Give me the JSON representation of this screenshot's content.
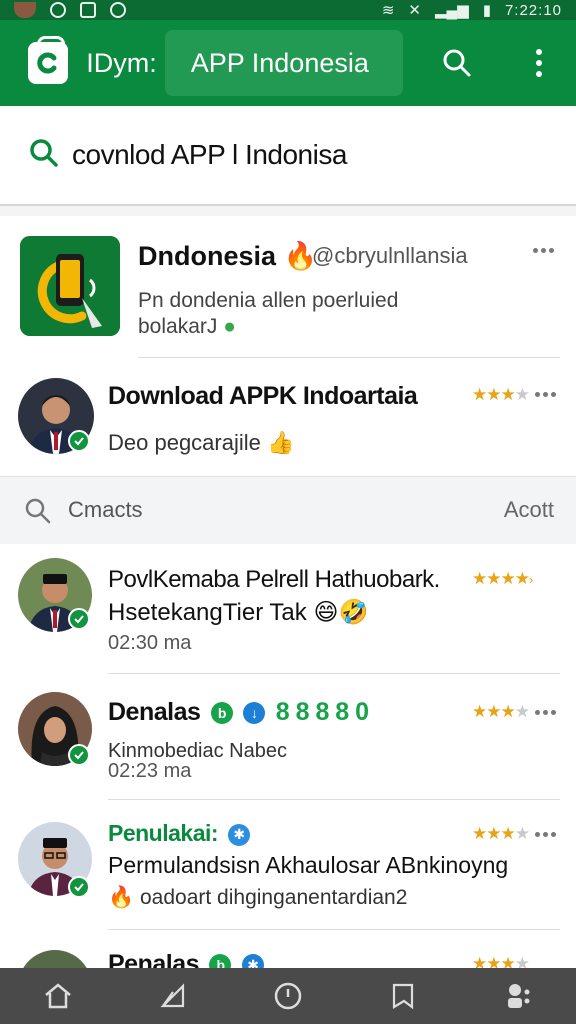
{
  "status_bar": {
    "time": "7:22:10"
  },
  "app_bar": {
    "title": "IDym:",
    "pill_title": "APP Indonesia",
    "icons": {
      "logo": "app-logo-icon",
      "search": "search-icon",
      "more": "more-vert-icon"
    },
    "color": "#0a8a3e"
  },
  "search": {
    "query": "covnlod APP l Indonisa",
    "icon": "search-icon"
  },
  "results": [
    {
      "name": "Dndonesia",
      "handle": "@cbryulnllansia",
      "desc": "Pn dondenia allen poerluied bolakarJ"
    },
    {
      "name": "Download APPK Indoartaia",
      "line": "Deo pegcarajile",
      "rating": 4
    }
  ],
  "section": {
    "label": "Cmacts",
    "action": "Acott"
  },
  "contacts": [
    {
      "name": "PovlKemaba Pelrell Hathuobark.",
      "line": "HsetekangTier Tak",
      "time": "02:30 ma",
      "rating": 4
    },
    {
      "name": "Denalas",
      "badges": "8 8 8 8 0",
      "time_line": "Kinmobediac Nabec",
      "time": "02:23 ma",
      "rating": 4
    },
    {
      "name": "Penulakai:",
      "line": "Permulandsisn Akhaulosar ABnkinoyng",
      "line2": "oadoart dihginganentardian2",
      "rating": 4
    },
    {
      "name": "Penalas"
    }
  ],
  "bottom_nav": [
    "home-icon",
    "share-icon",
    "clock-icon",
    "bookmark-icon",
    "profile-icon"
  ]
}
